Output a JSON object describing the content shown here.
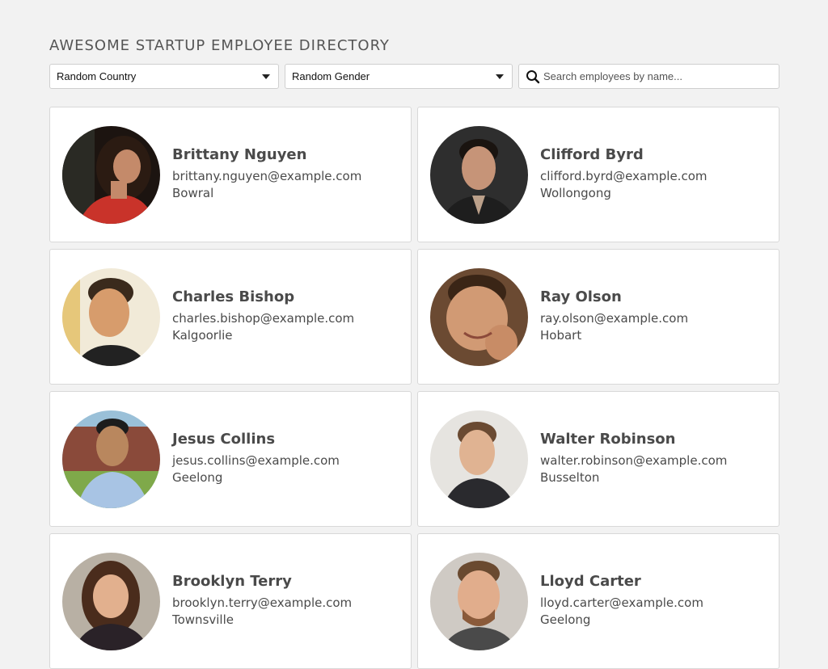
{
  "header": {
    "title": "AWESOME STARTUP EMPLOYEE DIRECTORY"
  },
  "filters": {
    "country": {
      "selected": "Random Country"
    },
    "gender": {
      "selected": "Random Gender"
    },
    "search": {
      "placeholder": "Search employees by name...",
      "value": ""
    }
  },
  "employees": [
    {
      "name": "Brittany Nguyen",
      "email": "brittany.nguyen@example.com",
      "city": "Bowral"
    },
    {
      "name": "Clifford Byrd",
      "email": "clifford.byrd@example.com",
      "city": "Wollongong"
    },
    {
      "name": "Charles Bishop",
      "email": "charles.bishop@example.com",
      "city": "Kalgoorlie"
    },
    {
      "name": "Ray Olson",
      "email": "ray.olson@example.com",
      "city": "Hobart"
    },
    {
      "name": "Jesus Collins",
      "email": "jesus.collins@example.com",
      "city": "Geelong"
    },
    {
      "name": "Walter Robinson",
      "email": "walter.robinson@example.com",
      "city": "Busselton"
    },
    {
      "name": "Brooklyn Terry",
      "email": "brooklyn.terry@example.com",
      "city": "Townsville"
    },
    {
      "name": "Lloyd Carter",
      "email": "lloyd.carter@example.com",
      "city": "Geelong"
    }
  ],
  "colors": {
    "background": "#f2f2f2",
    "card": "#ffffff",
    "text": "#4a4a4a"
  }
}
